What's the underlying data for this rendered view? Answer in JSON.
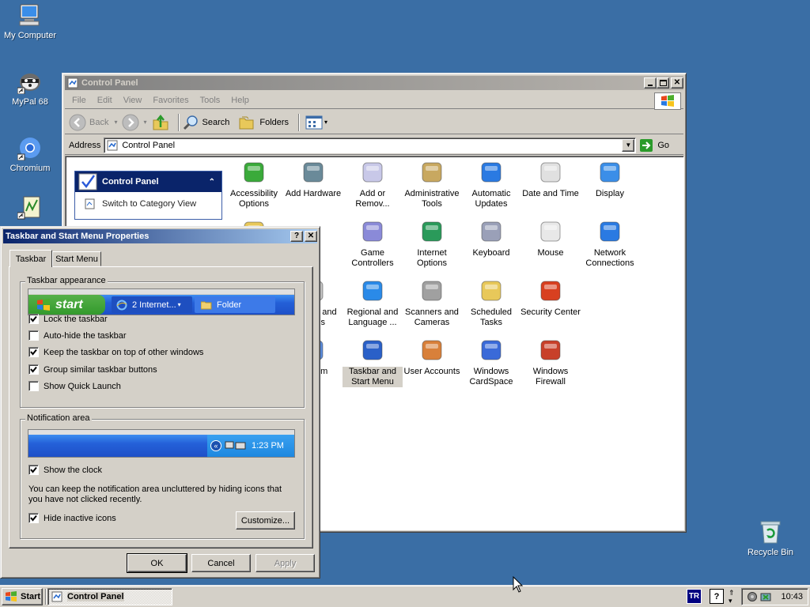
{
  "desktop": {
    "icons": [
      {
        "label": "My Computer",
        "icon": "my-computer-icon"
      },
      {
        "label": "MyPal 68",
        "icon": "mypal-icon"
      },
      {
        "label": "Chromium",
        "icon": "chromium-icon"
      },
      {
        "label": "",
        "icon": "app-shortcut-icon"
      },
      {
        "label": "Recycle Bin",
        "icon": "recycle-bin-icon"
      }
    ]
  },
  "control_panel": {
    "title": "Control Panel",
    "menu": [
      "File",
      "Edit",
      "View",
      "Favorites",
      "Tools",
      "Help"
    ],
    "toolbar": {
      "back": "Back",
      "search": "Search",
      "folders": "Folders"
    },
    "address_label": "Address",
    "address_value": "Control Panel",
    "go_label": "Go",
    "side_panel": {
      "title": "Control Panel",
      "link": "Switch to Category View"
    },
    "items": [
      {
        "label": "Accessibility Options",
        "icon": "accessibility-icon"
      },
      {
        "label": "Add Hardware",
        "icon": "add-hardware-icon"
      },
      {
        "label": "Add or Remov...",
        "icon": "add-remove-programs-icon"
      },
      {
        "label": "Administrative Tools",
        "icon": "administrative-tools-icon"
      },
      {
        "label": "Automatic Updates",
        "icon": "automatic-updates-icon"
      },
      {
        "label": "Date and Time",
        "icon": "date-time-icon"
      },
      {
        "label": "Display",
        "icon": "display-icon"
      },
      {
        "label": "nts",
        "icon": "fonts-icon"
      },
      {
        "label": "Game Controllers",
        "icon": "game-controllers-icon"
      },
      {
        "label": "Internet Options",
        "icon": "internet-options-icon"
      },
      {
        "label": "Keyboard",
        "icon": "keyboard-icon"
      },
      {
        "label": "Mouse",
        "icon": "mouse-icon"
      },
      {
        "label": "Network Connections",
        "icon": "network-connections-icon"
      },
      {
        "label": "Options",
        "icon": "phone-modem-icon"
      },
      {
        "label": "Printers and Faxes",
        "icon": "printers-faxes-icon"
      },
      {
        "label": "Regional and Language ...",
        "icon": "regional-language-icon"
      },
      {
        "label": "Scanners and Cameras",
        "icon": "scanners-cameras-icon"
      },
      {
        "label": "Scheduled Tasks",
        "icon": "scheduled-tasks-icon"
      },
      {
        "label": "Security Center",
        "icon": "security-center-icon"
      },
      {
        "label": "ech",
        "icon": "speech-icon"
      },
      {
        "label": "System",
        "icon": "system-icon"
      },
      {
        "label": "Taskbar and Start Menu",
        "icon": "taskbar-start-menu-icon"
      },
      {
        "label": "User Accounts",
        "icon": "user-accounts-icon"
      },
      {
        "label": "Windows CardSpace",
        "icon": "cardspace-icon"
      },
      {
        "label": "Windows Firewall",
        "icon": "firewall-icon"
      }
    ]
  },
  "dialog": {
    "title": "Taskbar and Start Menu Properties",
    "tabs": [
      "Taskbar",
      "Start Menu"
    ],
    "appearance_group": "Taskbar appearance",
    "preview": {
      "start": "start",
      "task1": "2 Internet...",
      "task2": "Folder"
    },
    "checks": [
      {
        "label": "Lock the taskbar",
        "checked": true
      },
      {
        "label": "Auto-hide the taskbar",
        "checked": false
      },
      {
        "label": "Keep the taskbar on top of other windows",
        "checked": true
      },
      {
        "label": "Group similar taskbar buttons",
        "checked": true
      },
      {
        "label": "Show Quick Launch",
        "checked": false
      }
    ],
    "notification_group": "Notification area",
    "notif_preview_time": "1:23 PM",
    "show_clock": {
      "label": "Show the clock",
      "checked": true
    },
    "notif_text": "You can keep the notification area uncluttered by hiding icons that you have not clicked recently.",
    "hide_inactive": {
      "label": "Hide inactive icons",
      "checked": true
    },
    "customize": "Customize...",
    "ok": "OK",
    "cancel": "Cancel",
    "apply": "Apply"
  },
  "taskbar": {
    "start": "Start",
    "task": "Control Panel",
    "lang": "TR",
    "clock": "10:43"
  },
  "colors": {
    "desktop": "#3a6ea5",
    "active_title": "#0a246a",
    "window_face": "#d4d0c8"
  }
}
